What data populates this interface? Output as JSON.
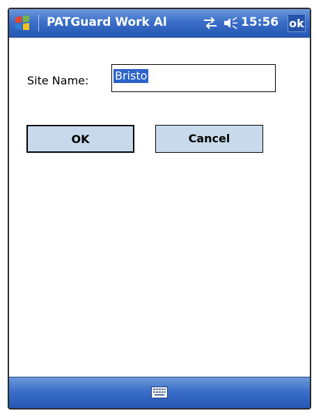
{
  "title_bar": {
    "title": "PATGuard Work Al",
    "clock": "15:56",
    "ok_label": "ok",
    "icons": [
      "windows-start-icon",
      "connectivity-icon",
      "volume-icon"
    ]
  },
  "form": {
    "site_label": "Site Name:",
    "site_value": "Bristo"
  },
  "buttons": {
    "ok_label": "OK",
    "cancel_label": "Cancel"
  },
  "bottom_bar": {
    "icons": [
      "keyboard-icon"
    ]
  },
  "colors": {
    "bar_blue": "#3b6fc9",
    "button_fill": "#c8d9eb",
    "selection_blue": "#2c63c8"
  }
}
